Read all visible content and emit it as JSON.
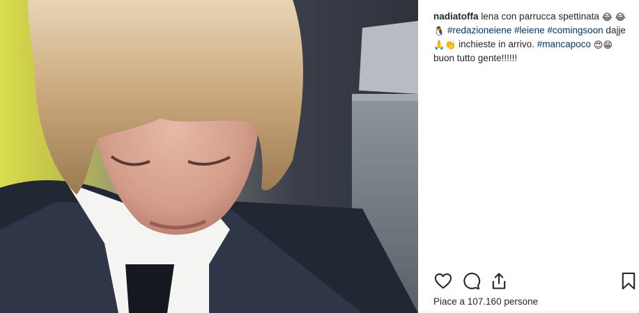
{
  "post": {
    "username": "nadiatoffa",
    "caption": {
      "text_1": " lena con parrucca spettinata ",
      "hashtag_1": "#redazioneiene",
      "hashtag_2": "#leiene",
      "hashtag_3": "#comingsoon",
      "text_2": " dajje ",
      "text_3": " inchieste in arrivo. ",
      "hashtag_4": "#mancapoco",
      "text_4": " buon tutto gente!!!!!!"
    },
    "likes_text": "Piace a 107.160 persone"
  },
  "icons": {
    "like": "heart-icon",
    "comment": "comment-bubble-icon",
    "share": "share-arrow-icon",
    "save": "bookmark-icon"
  },
  "colors": {
    "text": "#262626",
    "hashtag": "#003569"
  }
}
